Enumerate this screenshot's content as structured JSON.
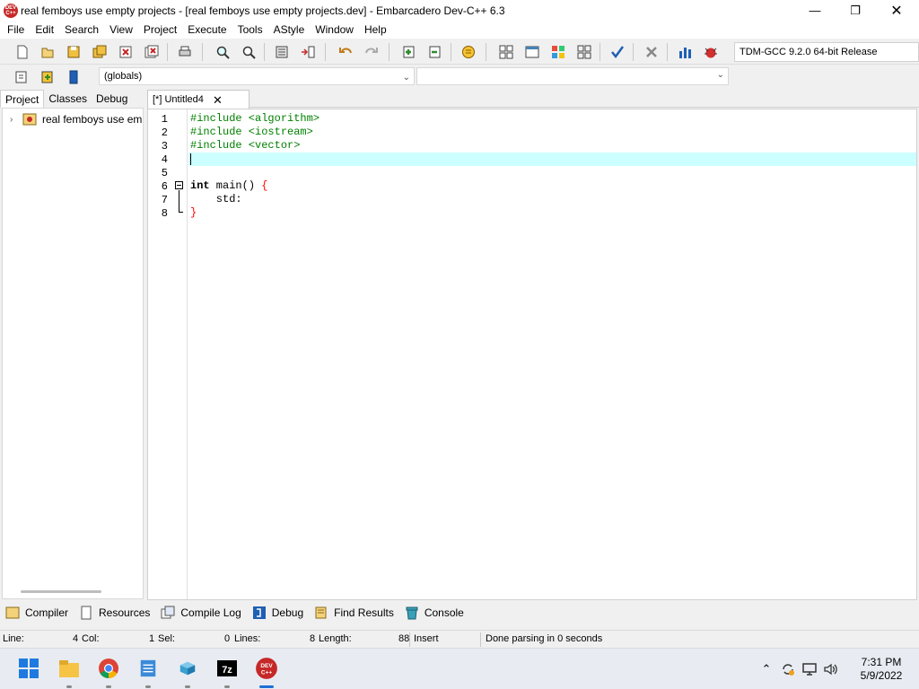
{
  "window": {
    "title": "real femboys use empty projects - [real femboys use empty projects.dev] - Embarcadero Dev-C++ 6.3",
    "app_icon_text": "DEV C++",
    "minimize_glyph": "—",
    "maximize_glyph": "❐",
    "close_glyph": "✕"
  },
  "menu": [
    "File",
    "Edit",
    "Search",
    "View",
    "Project",
    "Execute",
    "Tools",
    "AStyle",
    "Window",
    "Help"
  ],
  "toolbar": {
    "compiler": "TDM-GCC 9.2.0 64-bit Release",
    "globals": "(globals)",
    "members": ""
  },
  "left_panel": {
    "tabs": [
      "Project",
      "Classes",
      "Debug"
    ],
    "tree_item": "real femboys use empt"
  },
  "editor": {
    "tab_label": "[*] Untitled4",
    "lines": [
      "1",
      "2",
      "3",
      "4",
      "5",
      "6",
      "7",
      "8"
    ],
    "code": {
      "l1": "#include <algorithm>",
      "l2": "#include <iostream>",
      "l3": "#include <vector>",
      "l6_kw": "int",
      "l6_rest": " main() ",
      "l6_brace": "{",
      "l7": "    std:",
      "l8": "}"
    }
  },
  "bottom_tabs": [
    "Compiler",
    "Resources",
    "Compile Log",
    "Debug",
    "Find Results",
    "Console"
  ],
  "status": {
    "line_label": "Line:",
    "line_value": "4",
    "col_label": "Col:",
    "col_value": "1",
    "sel_label": "Sel:",
    "sel_value": "0",
    "lines_label": "Lines:",
    "lines_value": "8",
    "length_label": "Length:",
    "length_value": "88",
    "mode": "Insert",
    "message": "Done parsing in 0 seconds"
  },
  "taskbar": {
    "time": "7:31 PM",
    "date": "5/9/2022",
    "icons": [
      "windows-start",
      "file-explorer",
      "chrome",
      "notepad",
      "sandbox",
      "7zip",
      "devcpp"
    ]
  }
}
